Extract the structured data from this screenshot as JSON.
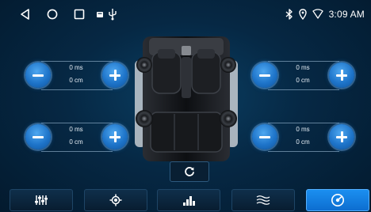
{
  "status_bar": {
    "time": "3:09 AM",
    "icons": [
      "back-icon",
      "home-icon",
      "recents-icon",
      "notification-icon",
      "usb-icon",
      "bluetooth-icon",
      "location-icon",
      "wifi-icon"
    ]
  },
  "speakers": {
    "front_left": {
      "delay": "0 ms",
      "distance": "0 cm"
    },
    "front_right": {
      "delay": "0 ms",
      "distance": "0 cm"
    },
    "rear_left": {
      "delay": "0 ms",
      "distance": "0 cm"
    },
    "rear_right": {
      "delay": "0 ms",
      "distance": "0 cm"
    }
  },
  "tabs": [
    "equalizer-tab",
    "balance-tab",
    "spectrum-tab",
    "sound-field-tab",
    "speaker-delay-tab"
  ],
  "active_tab": "speaker-delay-tab",
  "colors": {
    "accent": "#1e86e8",
    "background": "#062844"
  }
}
